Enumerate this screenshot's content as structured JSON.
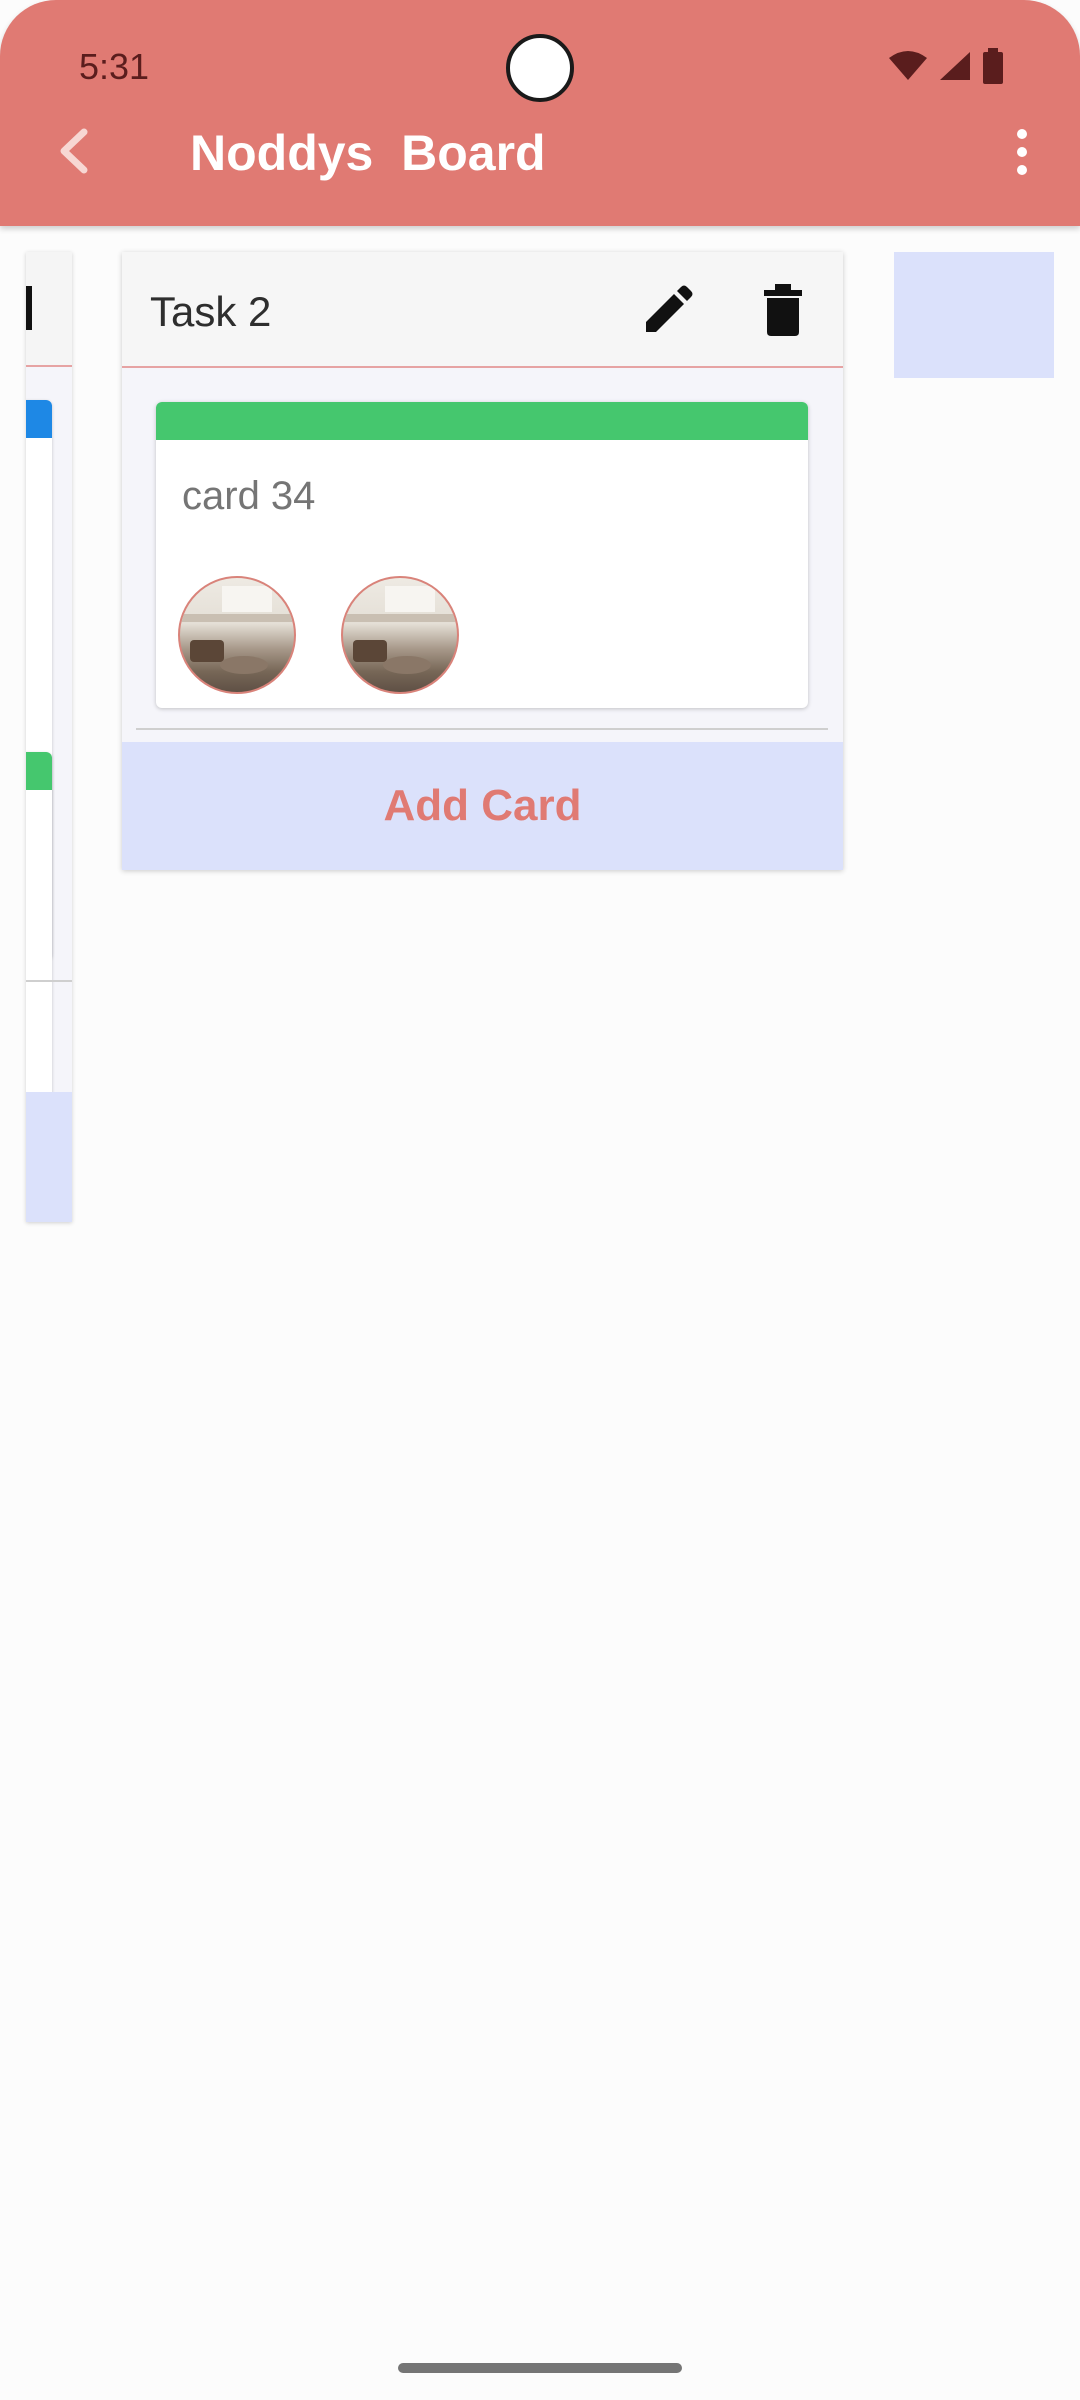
{
  "status_bar": {
    "time": "5:31"
  },
  "toolbar": {
    "title": "Noddys  Board",
    "back_icon": "chevron-left-icon",
    "more_icon": "more-vert-icon"
  },
  "column": {
    "title": "Task 2",
    "edit_icon": "pencil-icon",
    "delete_icon": "trash-icon",
    "cards": [
      {
        "title": "card 34",
        "label_color": "#45c76e",
        "members": [
          "member-avatar",
          "member-avatar"
        ]
      }
    ],
    "add_card_label": "Add Card"
  },
  "colors": {
    "appbar": "#e07a73",
    "add_card_bg": "#dbe1fb",
    "add_card_text": "#e07a73",
    "label_blue": "#1e88e5",
    "label_green": "#45c76e",
    "divider_accent": "#e6a3a3"
  }
}
